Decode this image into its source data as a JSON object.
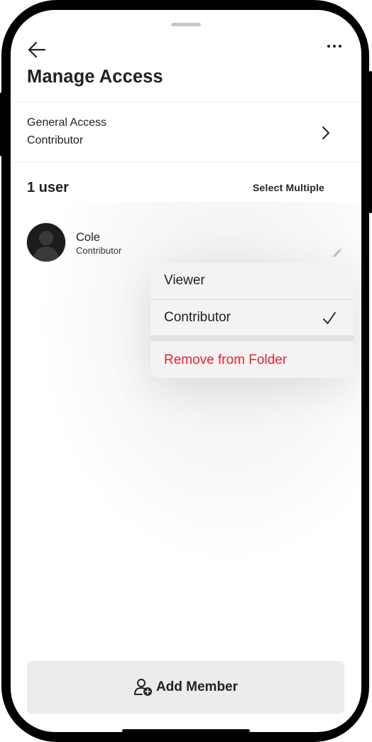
{
  "header": {
    "title": "Manage Access",
    "back_icon": "arrow-left-icon",
    "more_icon": "more-horizontal-icon"
  },
  "general_access": {
    "title": "General Access",
    "value": "Contributor",
    "chevron_icon": "chevron-right-icon"
  },
  "users": {
    "count_label": "1 user",
    "select_multiple_label": "Select Multiple",
    "members": [
      {
        "name": "Cole",
        "role": "Contributor",
        "avatar_icon": "avatar-silhouette-icon",
        "edit_icon": "pencil-icon"
      }
    ]
  },
  "role_menu": {
    "items": [
      {
        "label": "Viewer",
        "selected": false
      },
      {
        "label": "Contributor",
        "selected": true
      }
    ],
    "check_icon": "checkmark-icon",
    "remove_label": "Remove from Folder",
    "remove_color": "#e3262a"
  },
  "footer": {
    "add_member_label": "Add Member",
    "add_member_icon": "add-user-icon"
  },
  "colors": {
    "text": "#222222",
    "button_bg": "#ececec",
    "menu_bg": "#f3f3f3",
    "danger": "#e3262a"
  }
}
